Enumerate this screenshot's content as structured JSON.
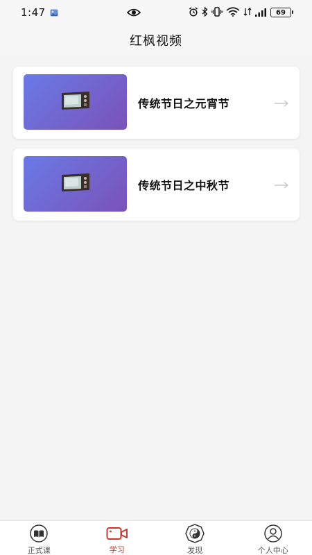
{
  "status_bar": {
    "time": "1:47",
    "battery": "69"
  },
  "header": {
    "title": "红枫视频"
  },
  "videos": [
    {
      "title": "传统节日之元宵节",
      "thumbnail_icon": "tv-icon"
    },
    {
      "title": "传统节日之中秋节",
      "thumbnail_icon": "tv-icon"
    }
  ],
  "bottom_nav": [
    {
      "label": "正式课",
      "icon": "book-icon",
      "active": false
    },
    {
      "label": "学习",
      "icon": "video-camera-icon",
      "active": true
    },
    {
      "label": "发现",
      "icon": "yin-yang-icon",
      "active": false
    },
    {
      "label": "个人中心",
      "icon": "user-icon",
      "active": false
    }
  ],
  "colors": {
    "accent": "#c8372d",
    "thumb_gradient_start": "#6a7ae6",
    "thumb_gradient_end": "#7a52b8",
    "background": "#f4f4f4"
  }
}
